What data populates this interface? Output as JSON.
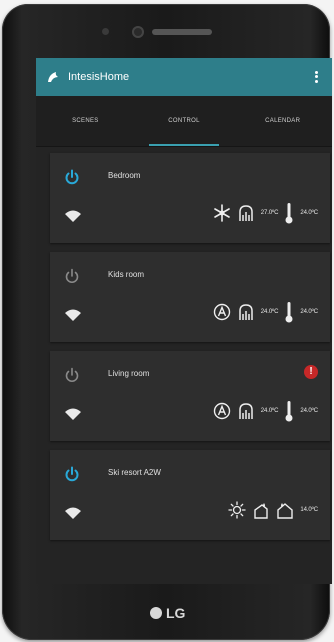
{
  "app": {
    "title": "IntesisHome"
  },
  "tabs": [
    {
      "label": "SCENES",
      "active": false
    },
    {
      "label": "CONTROL",
      "active": true
    },
    {
      "label": "CALENDAR",
      "active": false
    }
  ],
  "rooms": [
    {
      "name": "Bedroom",
      "power": "on",
      "mode_icon": "snowflake-icon",
      "fan_icon": "fan-icon",
      "setpoint": "27.0ºC",
      "current": "24.0ºC",
      "alert": false
    },
    {
      "name": "Kids room",
      "power": "off",
      "mode_icon": "auto-mode-icon",
      "fan_icon": "fan-icon",
      "setpoint": "24.0ºC",
      "current": "24.0ºC",
      "alert": false
    },
    {
      "name": "Living room",
      "power": "off",
      "mode_icon": "auto-mode-icon",
      "fan_icon": "fan-icon",
      "setpoint": "24.0ºC",
      "current": "24.0ºC",
      "alert": true,
      "alert_text": "!"
    },
    {
      "name": "Ski resort A2W",
      "power": "on",
      "mode_icon": "sun-icon",
      "fan_icon": "water-icon",
      "setpoint": "",
      "current": "14.0ºC",
      "alert": false
    }
  ],
  "device": {
    "brand": "LG"
  },
  "colors": {
    "accent": "#2e7e8a",
    "power_on": "#29a9d8",
    "power_off": "#8a8a8a",
    "alert": "#c62828"
  }
}
